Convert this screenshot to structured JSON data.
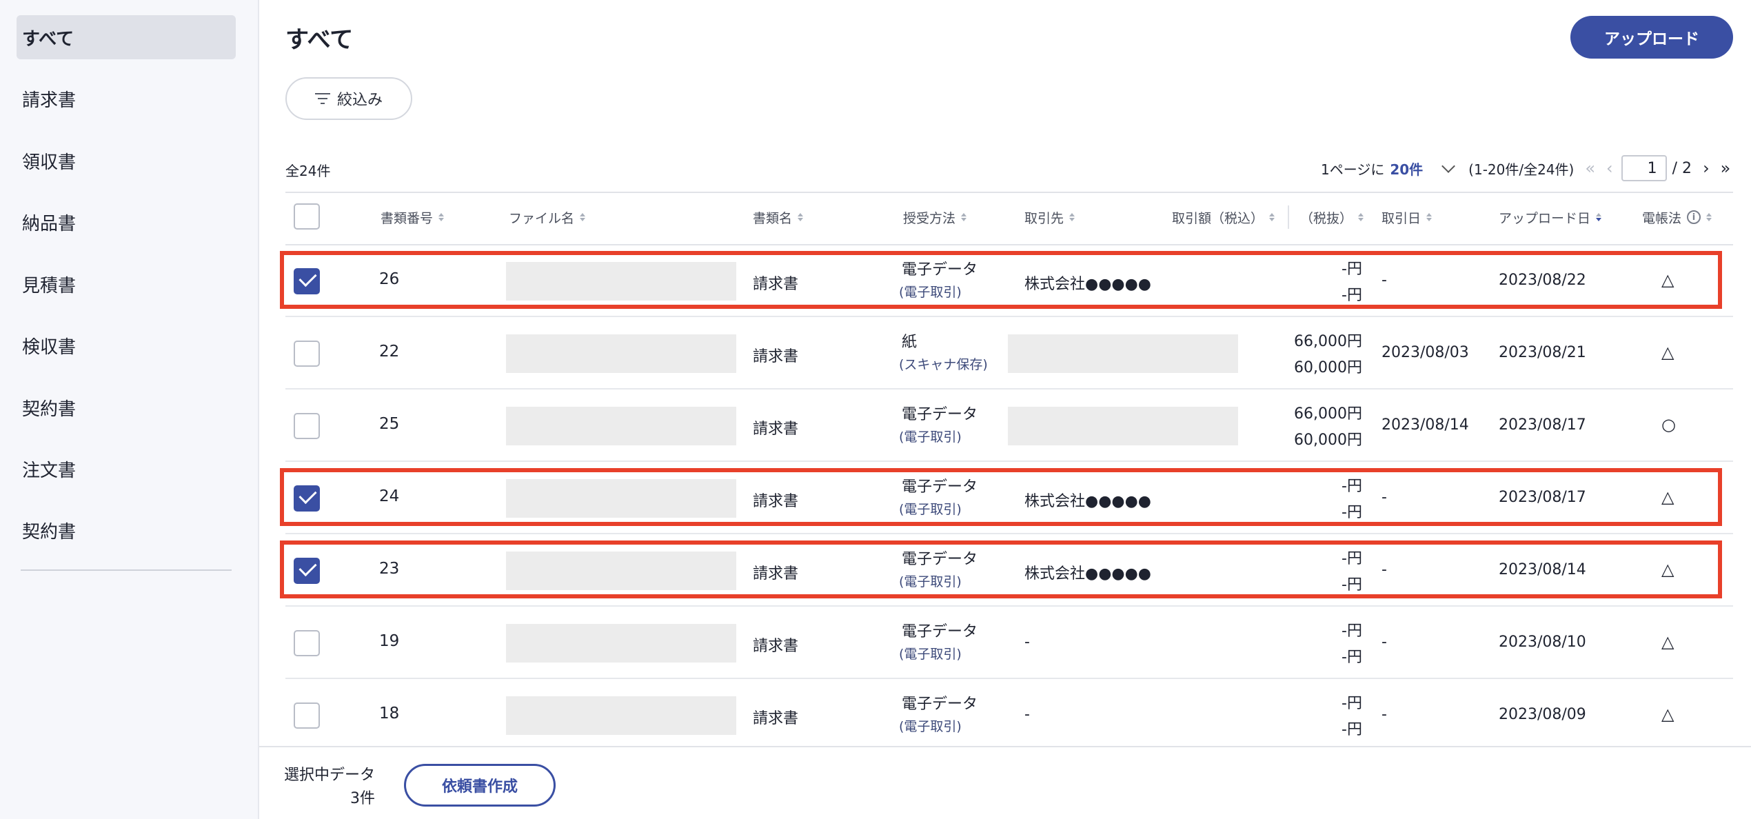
{
  "sidebar": {
    "items": [
      {
        "label": "すべて",
        "active": true
      },
      {
        "label": "請求書"
      },
      {
        "label": "領収書"
      },
      {
        "label": "納品書"
      },
      {
        "label": "見積書"
      },
      {
        "label": "検収書"
      },
      {
        "label": "契約書"
      },
      {
        "label": "注文書"
      },
      {
        "label": "契約書"
      }
    ]
  },
  "header": {
    "title": "すべて",
    "upload_label": "アップロード",
    "filter_label": "絞込み"
  },
  "summary": {
    "total": "全24件"
  },
  "pager": {
    "per_page_prefix": "1ページに",
    "per_page_value": "20件",
    "range": "(1-20件/全24件)",
    "first": "«",
    "prev": "‹",
    "current_page": "1",
    "total_pages": "/ 2",
    "next": "›",
    "last": "»"
  },
  "table": {
    "columns": [
      "書類番号",
      "ファイル名",
      "書類名",
      "授受方法",
      "取引先",
      "取引額（税込）",
      "（税抜）",
      "取引日",
      "アップロード日",
      "電帳法"
    ],
    "rows": [
      {
        "checked": true,
        "number": "26",
        "doc": "請求書",
        "method": "電子データ",
        "method_sub": "(電子取引)",
        "partner": "株式会社●●●●●",
        "partner_blank": false,
        "amount_incl": "-円",
        "amount_excl": "-円",
        "trade_date": "-",
        "upload_date": "2023/08/22",
        "law": "△"
      },
      {
        "checked": false,
        "number": "22",
        "doc": "請求書",
        "method": "紙",
        "method_sub": "(スキャナ保存)",
        "partner": "",
        "partner_blank": true,
        "amount_incl": "66,000円",
        "amount_excl": "60,000円",
        "trade_date": "2023/08/03",
        "upload_date": "2023/08/21",
        "law": "△"
      },
      {
        "checked": false,
        "number": "25",
        "doc": "請求書",
        "method": "電子データ",
        "method_sub": "(電子取引)",
        "partner": "",
        "partner_blank": true,
        "amount_incl": "66,000円",
        "amount_excl": "60,000円",
        "trade_date": "2023/08/14",
        "upload_date": "2023/08/17",
        "law": "○"
      },
      {
        "checked": true,
        "number": "24",
        "doc": "請求書",
        "method": "電子データ",
        "method_sub": "(電子取引)",
        "partner": "株式会社●●●●●",
        "partner_blank": false,
        "amount_incl": "-円",
        "amount_excl": "-円",
        "trade_date": "-",
        "upload_date": "2023/08/17",
        "law": "△"
      },
      {
        "checked": true,
        "number": "23",
        "doc": "請求書",
        "method": "電子データ",
        "method_sub": "(電子取引)",
        "partner": "株式会社●●●●●",
        "partner_blank": false,
        "amount_incl": "-円",
        "amount_excl": "-円",
        "trade_date": "-",
        "upload_date": "2023/08/14",
        "law": "△"
      },
      {
        "checked": false,
        "number": "19",
        "doc": "請求書",
        "method": "電子データ",
        "method_sub": "(電子取引)",
        "partner": "-",
        "partner_blank": false,
        "amount_incl": "-円",
        "amount_excl": "-円",
        "trade_date": "-",
        "upload_date": "2023/08/10",
        "law": "△"
      },
      {
        "checked": false,
        "number": "18",
        "doc": "請求書",
        "method": "電子データ",
        "method_sub": "(電子取引)",
        "partner": "-",
        "partner_blank": false,
        "amount_incl": "-円",
        "amount_excl": "-円",
        "trade_date": "-",
        "upload_date": "2023/08/09",
        "law": "△"
      }
    ]
  },
  "footer": {
    "selected_label": "選択中データ",
    "selected_count": "3件",
    "request_label": "依頼書作成"
  },
  "colors": {
    "accent": "#3a4fa3",
    "highlight": "#e8402a"
  }
}
